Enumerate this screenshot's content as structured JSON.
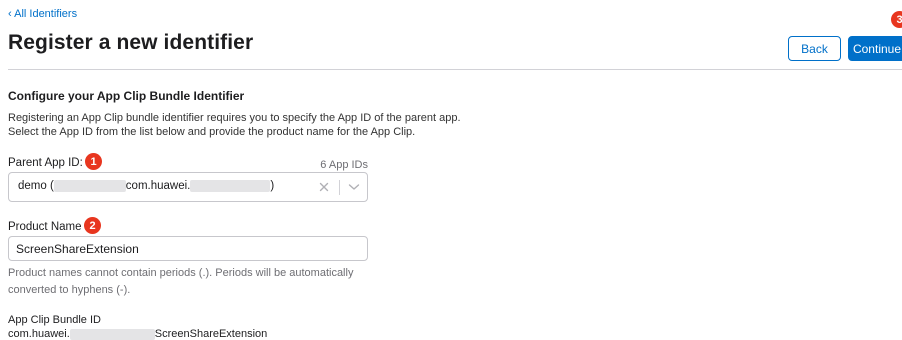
{
  "nav": {
    "back_link": "‹ All Identifiers"
  },
  "header": {
    "title": "Register a new identifier",
    "back_button": "Back",
    "continue_button": "Continue"
  },
  "section": {
    "heading": "Configure your App Clip Bundle Identifier",
    "description_line1": "Registering an App Clip bundle identifier requires you to specify the App ID of the parent app.",
    "description_line2": "Select the App ID from the list below and provide the product name for the App Clip."
  },
  "parent_app": {
    "label": "Parent App ID:",
    "count": "6 App IDs",
    "value_prefix": "demo (",
    "value_middle": "com.huawei.",
    "value_suffix": ")"
  },
  "product_name": {
    "label": "Product Name",
    "value": "ScreenShareExtension",
    "help": "Product names cannot contain periods (.). Periods will be automatically converted to hyphens (-)."
  },
  "bundle_id": {
    "label": "App Clip Bundle ID",
    "value_prefix": "com.huawei.",
    "value_suffix": "ScreenShareExtension"
  },
  "badges": {
    "one": "1",
    "two": "2",
    "three": "3"
  },
  "colors": {
    "accent": "#0070c9",
    "badge": "#e8361f",
    "divider": "#d2d2d7"
  },
  "icons": {
    "clear": "close-icon",
    "dropdown": "chevron-down-icon"
  }
}
